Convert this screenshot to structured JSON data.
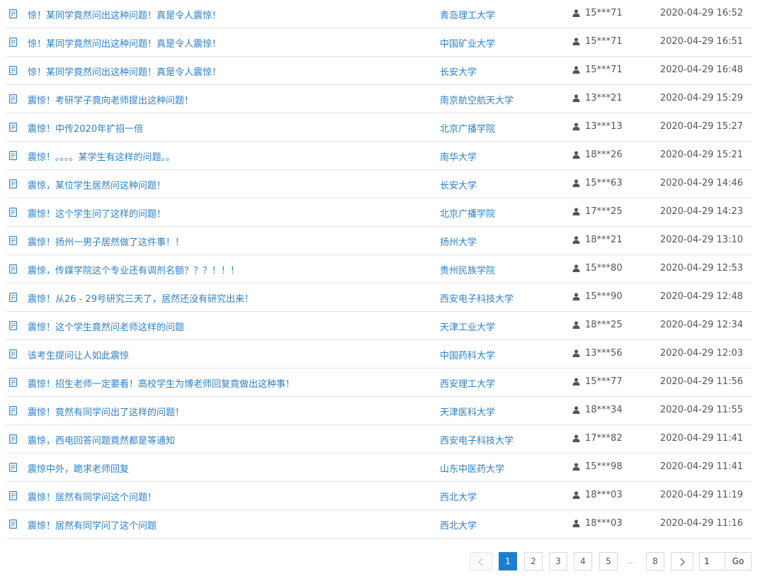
{
  "colors": {
    "link": "#2d80c8",
    "active_page": "#1b7fd1",
    "divider": "#e6e6e6"
  },
  "rows": [
    {
      "title": "惊！某同学竟然问出这种问题！真是令人震惊！",
      "school": "青岛理工大学",
      "user": "15***71",
      "time": "2020-04-29 16:52"
    },
    {
      "title": "惊！某同学竟然问出这种问题！真是令人震惊！",
      "school": "中国矿业大学",
      "user": "15***71",
      "time": "2020-04-29 16:51"
    },
    {
      "title": "惊！某同学竟然问出这种问题！真是令人震惊！",
      "school": "长安大学",
      "user": "15***71",
      "time": "2020-04-29 16:48"
    },
    {
      "title": "震惊！考研学子竟向老师提出这种问题！",
      "school": "南京航空航天大学",
      "user": "13***21",
      "time": "2020-04-29 15:29"
    },
    {
      "title": "震惊！中传2020年扩招一倍",
      "school": "北京广播学院",
      "user": "13***13",
      "time": "2020-04-29 15:27"
    },
    {
      "title": "震惊！。。。。某学生有这样的问题。。",
      "school": "南华大学",
      "user": "18***26",
      "time": "2020-04-29 15:21"
    },
    {
      "title": "震惊，某位学生居然问这种问题！",
      "school": "长安大学",
      "user": "15***63",
      "time": "2020-04-29 14:46"
    },
    {
      "title": "震惊！这个学生问了这样的问题！",
      "school": "北京广播学院",
      "user": "17***25",
      "time": "2020-04-29 14:23"
    },
    {
      "title": "震惊！扬州一男子居然做了这件事！！",
      "school": "扬州大学",
      "user": "18***21",
      "time": "2020-04-29 13:10"
    },
    {
      "title": "震惊，传媒学院这个专业还有调剂名额？？？！！！",
      "school": "贵州民族学院",
      "user": "15***80",
      "time": "2020-04-29 12:53"
    },
    {
      "title": "震惊！从26 - 29号研究三天了，居然还没有研究出来！",
      "school": "西安电子科技大学",
      "user": "15***90",
      "time": "2020-04-29 12:48"
    },
    {
      "title": "震惊！这个学生竟然问老师这样的问题",
      "school": "天津工业大学",
      "user": "18***25",
      "time": "2020-04-29 12:34"
    },
    {
      "title": "该考生提问让人如此震惊",
      "school": "中国药科大学",
      "user": "13***56",
      "time": "2020-04-29 12:03"
    },
    {
      "title": "震惊！招生老师一定要看！高校学生为博老师回复竟做出这种事！",
      "school": "西安理工大学",
      "user": "15***77",
      "time": "2020-04-29 11:56"
    },
    {
      "title": "震惊！竟然有同学问出了这样的问题！",
      "school": "天津医科大学",
      "user": "18***34",
      "time": "2020-04-29 11:55"
    },
    {
      "title": "震惊，西电回答问题竟然都是等通知",
      "school": "西安电子科技大学",
      "user": "17***82",
      "time": "2020-04-29 11:41"
    },
    {
      "title": "震惊中外，跪求老师回复",
      "school": "山东中医药大学",
      "user": "15***98",
      "time": "2020-04-29 11:41"
    },
    {
      "title": "震惊！居然有同学问这个问题！",
      "school": "西北大学",
      "user": "18***03",
      "time": "2020-04-29 11:19"
    },
    {
      "title": "震惊！居然有同学问了这个问题",
      "school": "西北大学",
      "user": "18***03",
      "time": "2020-04-29 11:16"
    }
  ],
  "pagination": {
    "pages": [
      "1",
      "2",
      "3",
      "4",
      "5"
    ],
    "current": "1",
    "ellipsis": "...",
    "last": "8",
    "jump_value": "1",
    "go_label": "Go",
    "prev_icon": "chevron-left-icon",
    "next_icon": "chevron-right-icon"
  }
}
